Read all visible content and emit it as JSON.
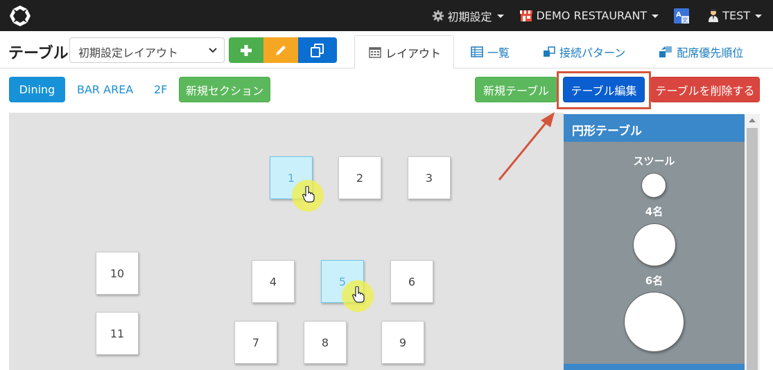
{
  "navbar": {
    "settings_label": "初期設定",
    "restaurant_label": "DEMO RESTAURANT",
    "user_label": "TEST"
  },
  "header": {
    "page_title": "テーブル",
    "layout_select_value": "初期設定レイアウト",
    "tabs": [
      {
        "label": "レイアウト",
        "icon": "calendar-grid-icon"
      },
      {
        "label": "一覧",
        "icon": "list-table-icon"
      },
      {
        "label": "接続パターン",
        "icon": "link-squares-icon"
      },
      {
        "label": "配席優先順位",
        "icon": "priority-icon"
      }
    ]
  },
  "sections": {
    "items": [
      "Dining",
      "BAR AREA",
      "2F"
    ],
    "new_section_label": "新規セクション",
    "new_table_label": "新規テーブル",
    "edit_table_label": "テーブル編集",
    "delete_table_label": "テーブルを削除する"
  },
  "tables": [
    {
      "label": "1",
      "selected": true
    },
    {
      "label": "2",
      "selected": false
    },
    {
      "label": "3",
      "selected": false
    },
    {
      "label": "10",
      "selected": false
    },
    {
      "label": "4",
      "selected": false
    },
    {
      "label": "5",
      "selected": true
    },
    {
      "label": "6",
      "selected": false
    },
    {
      "label": "11",
      "selected": false
    },
    {
      "label": "7",
      "selected": false
    },
    {
      "label": "8",
      "selected": false
    },
    {
      "label": "9",
      "selected": false
    }
  ],
  "panel": {
    "title": "円形テーブル",
    "shapes": [
      {
        "label": "スツール"
      },
      {
        "label": "4名"
      },
      {
        "label": "6名"
      }
    ]
  },
  "colors": {
    "highlight": "#d4553a",
    "accent_blue": "#1791d7",
    "selected_table": "#c9f0fb"
  }
}
